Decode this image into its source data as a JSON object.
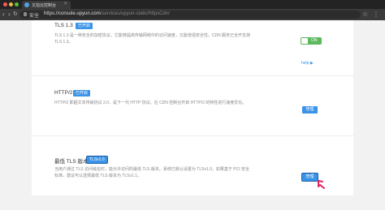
{
  "browser": {
    "tab_title": "又拍云控制台",
    "tab_close": "×",
    "back": "‹",
    "forward": "›",
    "reload": "↻",
    "secure_label": "安全",
    "url_host": "https://console.upyun.com",
    "url_path": "/services/upyun-static/httpsCdn/",
    "star": "☆",
    "menu": "⋮"
  },
  "sections": {
    "tls13": {
      "title": "TLS 1.3",
      "badge": "已开启",
      "desc": "TLS 1.3 是一种安全的加密协议，它能够提高传输网络中的访问速度，又能增强安全性。CDN 服务已全开支持 TLS 1.3。",
      "toggle": "ON",
      "help": "help ▶"
    },
    "http2": {
      "title": "HTTP/2",
      "badge": "已开启",
      "desc": "HTTP/2 即超文本传输协议 2.0，是下一代 HTTP 协议。在 CDN 控制台开启 HTTP/2 的特性进行速度优化。",
      "button": "管理"
    },
    "min_tls": {
      "title": "最低 TLS 版本",
      "badge": "TLSv1.0",
      "desc": "当用户通过 TLS 访问域名时，能允许访问的最低 TLS 版本。系统已默认设置为 TLSv1.0，如果基于 PCI 安全标准，建议可以选择最低 TLS 版本为 TLSv1.1。",
      "button": "管理"
    }
  },
  "colors": {
    "accent": "#3a93e8",
    "toggle_on": "#5cb85c",
    "pointer": "#e0245e"
  }
}
